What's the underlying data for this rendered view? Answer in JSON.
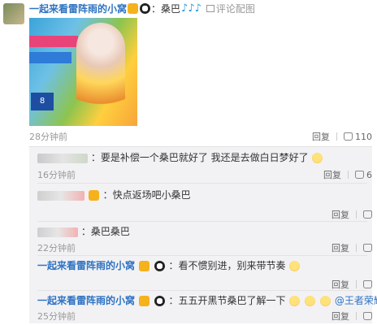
{
  "main_post": {
    "username": "一起来看雷阵雨的小窝",
    "text": "：桑巴",
    "notes": "♪♪♪",
    "pic_link": "评论配图",
    "image_sign": "8",
    "time": "28分钟前",
    "reply_label": "回复",
    "like_count": "110"
  },
  "replies": [
    {
      "text": "：要是补偿一个桑巴就好了  我还是去做白日梦好了",
      "time": "16分钟前",
      "reply_label": "回复",
      "like_count": "6"
    },
    {
      "text": "：快点返场吧小桑巴",
      "time": "",
      "reply_label": "回复"
    },
    {
      "text": "：桑巴桑巴",
      "time": "22分钟前",
      "reply_label": "回复"
    },
    {
      "username": "一起来看雷阵雨的小窝",
      "text": "：看不惯别进，别来带节奏",
      "time": "",
      "reply_label": "回复"
    },
    {
      "username": "一起来看雷阵雨的小窝",
      "text": "：五五开黑节桑巴了解一下",
      "mention": "@王者荣耀",
      "time": "25分钟前",
      "reply_label": "回复"
    }
  ],
  "colors": {
    "username": "#2f73c2",
    "time": "#999999",
    "reply_bg": "#f2f2f5"
  },
  "icons": [
    "vip-badge-icon",
    "panda-emoji-icon",
    "music-note-icon",
    "picture-icon",
    "thumbs-up-icon",
    "smile-emoji-icon",
    "doge-emoji-icon"
  ]
}
